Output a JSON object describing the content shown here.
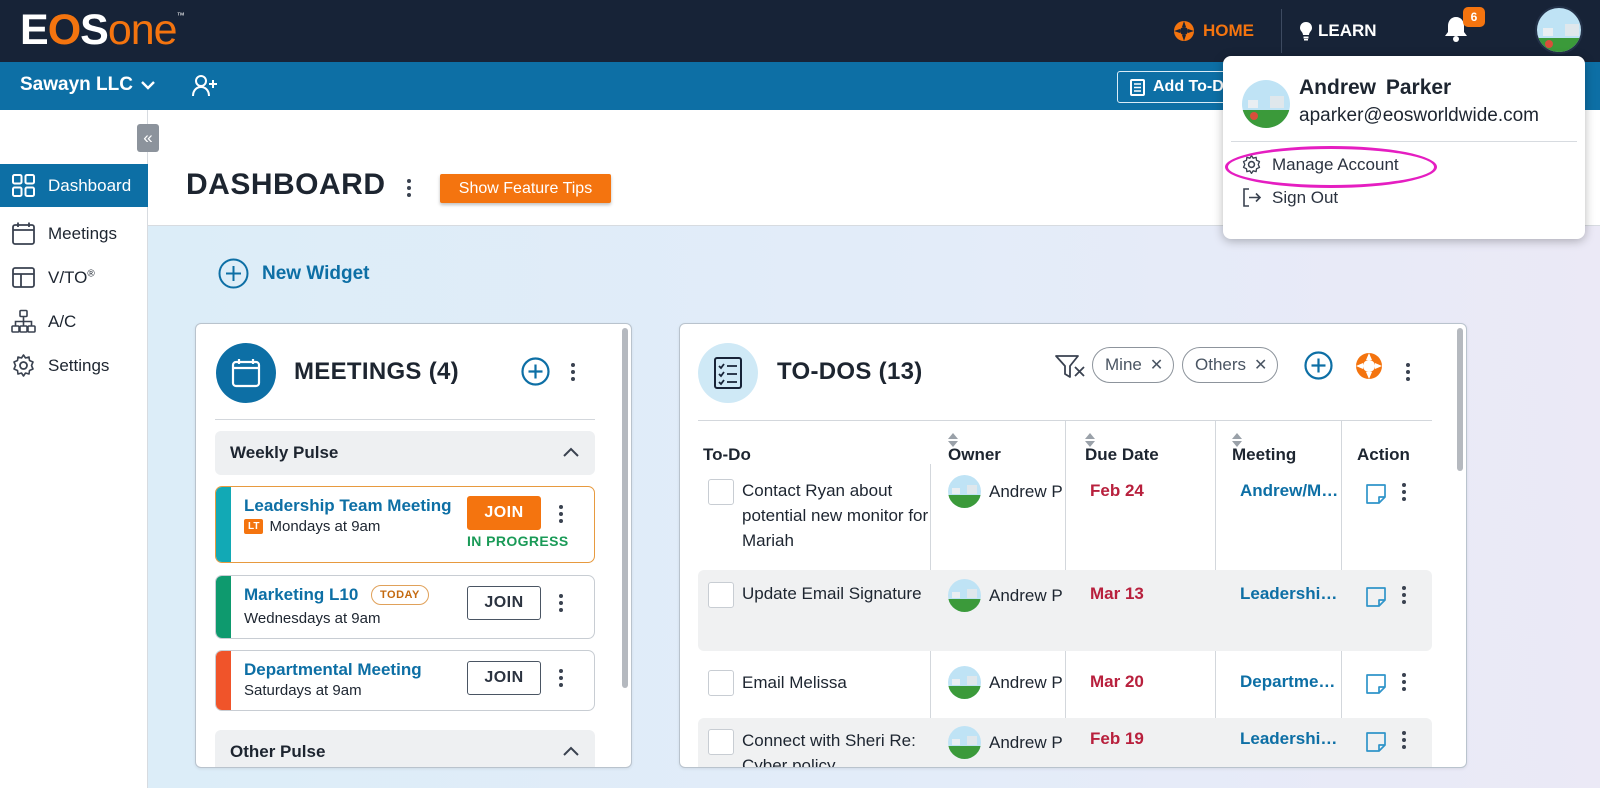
{
  "app": {
    "logo_parts": [
      "E",
      "O",
      "S",
      "one",
      "™"
    ]
  },
  "topnav": {
    "home_label": "HOME",
    "learn_label": "LEARN",
    "notification_count": "6"
  },
  "orgbar": {
    "org_name": "Sawayn LLC",
    "add_todo_label": "Add To-Do"
  },
  "sidebar": {
    "collapse_glyph": "«",
    "items": [
      {
        "label": "Dashboard",
        "icon": "grid-icon",
        "active": true
      },
      {
        "label": "Meetings",
        "icon": "calendar-icon",
        "active": false
      },
      {
        "label": "V/TO",
        "sup": "®",
        "icon": "layout-icon",
        "active": false
      },
      {
        "label": "A/C",
        "icon": "org-chart-icon",
        "active": false
      },
      {
        "label": "Settings",
        "icon": "gear-icon",
        "active": false
      }
    ]
  },
  "header": {
    "title": "DASHBOARD",
    "feature_tips_label": "Show Feature Tips"
  },
  "new_widget_label": "New Widget",
  "meetings_widget": {
    "title": "MEETINGS (4)",
    "sections": [
      {
        "title": "Weekly Pulse",
        "meetings": [
          {
            "name": "Leadership Team Meeting",
            "badge": "LT",
            "schedule": "Mondays at 9am",
            "join_label": "JOIN",
            "status": "IN PROGRESS",
            "color": "#12a9b5"
          },
          {
            "name": "Marketing L10",
            "tag": "TODAY",
            "schedule": "Wednesdays at 9am",
            "join_label": "JOIN",
            "color": "#0e9a6e"
          },
          {
            "name": "Departmental Meeting",
            "schedule": "Saturdays at 9am",
            "join_label": "JOIN",
            "color": "#f0542a"
          }
        ]
      },
      {
        "title": "Other Pulse"
      }
    ]
  },
  "todos_widget": {
    "title": "TO-DOS (13)",
    "filters": [
      "Mine",
      "Others"
    ],
    "columns": [
      "To-Do",
      "Owner",
      "Due Date",
      "Meeting",
      "Action"
    ],
    "rows": [
      {
        "text": "Contact Ryan about potential new monitor for Mariah",
        "owner": "Andrew P",
        "due": "Feb 24",
        "meeting": "Andrew/Mariah"
      },
      {
        "text": "Update Email Signature",
        "owner": "Andrew P",
        "due": "Mar 13",
        "meeting": "Leadership Team Meeting"
      },
      {
        "text": "Email Melissa",
        "owner": "Andrew P",
        "due": "Mar 20",
        "meeting": "Departmental Meeting"
      },
      {
        "text": "Connect with Sheri Re: Cyber policy",
        "owner": "Andrew P",
        "due": "Feb 19",
        "meeting": "Leadership Team Meeting"
      }
    ]
  },
  "account_menu": {
    "name": "Andrew Parker",
    "email": "aparker@eosworldwide.com",
    "items": [
      {
        "label": "Manage Account",
        "icon": "gear-icon"
      },
      {
        "label": "Sign Out",
        "icon": "sign-out-icon"
      }
    ]
  },
  "colors": {
    "navy": "#172337",
    "brand_blue": "#0d6fa5",
    "orange": "#f4740f",
    "due_red": "#b8203d",
    "highlight": "#e51ec1"
  }
}
